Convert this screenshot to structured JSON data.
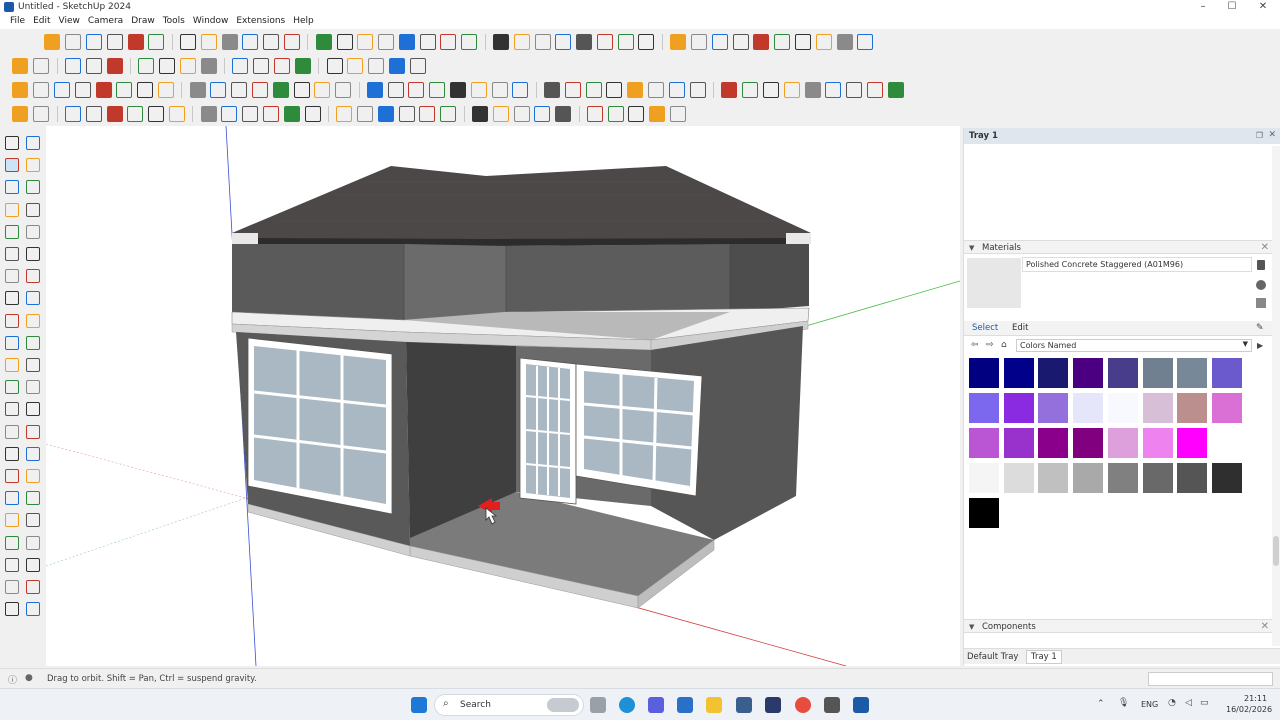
{
  "window": {
    "title": "Untitled - SketchUp 2024",
    "minimize": "–",
    "maximize": "☐",
    "close": "✕"
  },
  "menu": [
    "File",
    "Edit",
    "View",
    "Camera",
    "Draw",
    "Tools",
    "Window",
    "Extensions",
    "Help"
  ],
  "tray": {
    "title": "Tray 1",
    "materials": {
      "header": "Materials",
      "material_name": "Polished Concrete Staggered (A01M96)",
      "tab_select": "Select",
      "tab_edit": "Edit",
      "library": "Colors Named",
      "swatches": [
        "#000080",
        "#00008b",
        "#191970",
        "#4b0082",
        "#483d8b",
        "#708090",
        "#778899",
        "#6a5acd",
        "#7b68ee",
        "#8a2be2",
        "#9370db",
        "#e6e6fa",
        "#f8f8ff",
        "#d8bfd8",
        "#bc8f8f",
        "#da70d6",
        "#ba55d3",
        "#9932cc",
        "#8b008b",
        "#800080",
        "#dda0dd",
        "#ee82ee",
        "#ff00ff",
        "#ffffff",
        "#f5f5f5",
        "#dcdcdc",
        "#c0c0c0",
        "#a9a9a9",
        "#808080",
        "#696969",
        "#555555",
        "#2f2f2f",
        "#000000"
      ]
    },
    "components": {
      "header": "Components"
    },
    "bottom_tabs": [
      "Default Tray",
      "Tray 1"
    ]
  },
  "status": {
    "hint": "Drag to orbit. Shift = Pan, Ctrl = suspend gravity."
  },
  "taskbar": {
    "search_label": "Search",
    "lang": "ENG",
    "time": "21:11",
    "date": "16/02/2026"
  }
}
